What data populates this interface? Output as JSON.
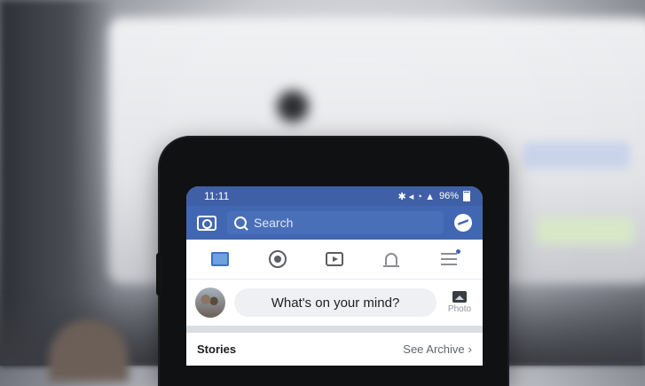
{
  "status_bar": {
    "time": "11:11",
    "signal_icons": "✱ ◂ ◔ ▲",
    "battery": "96%"
  },
  "search": {
    "placeholder": "Search"
  },
  "nav": {
    "items": [
      {
        "name": "news-feed-icon"
      },
      {
        "name": "groups-icon"
      },
      {
        "name": "watch-icon"
      },
      {
        "name": "notifications-icon"
      },
      {
        "name": "menu-icon"
      }
    ]
  },
  "composer": {
    "prompt": "What's on your mind?",
    "photo_label": "Photo"
  },
  "stories": {
    "title": "Stories",
    "archive_label": "See Archive",
    "archive_chevron": "›"
  },
  "colors": {
    "brand": "#4267b2",
    "status": "#3f5fa7"
  }
}
